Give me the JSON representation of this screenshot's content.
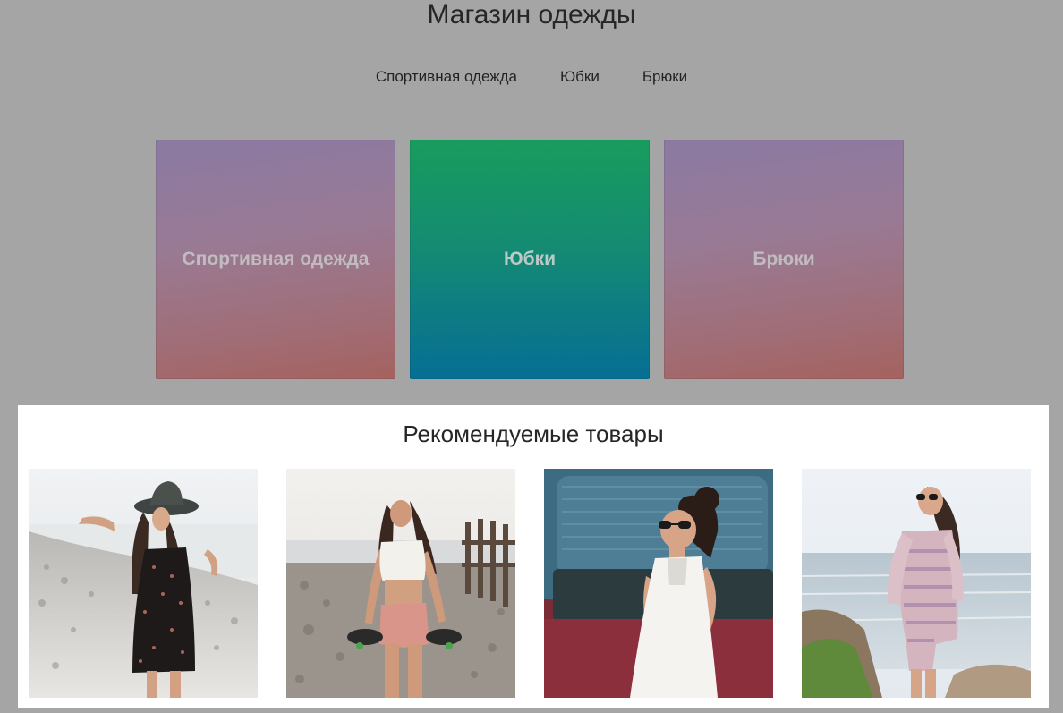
{
  "header": {
    "title": "Магазин одежды"
  },
  "nav": {
    "items": [
      {
        "label": "Спортивная одежда"
      },
      {
        "label": "Юбки"
      },
      {
        "label": "Брюки"
      }
    ]
  },
  "categories": [
    {
      "label": "Спортивная одежда",
      "color": "#9a7a96"
    },
    {
      "label": "Юбки",
      "color": "#148b72"
    },
    {
      "label": "Брюки",
      "color": "#9a7a96"
    }
  ],
  "featured": {
    "title": "Рекомендуемые товары",
    "products": [
      {
        "image": "woman-beach-hat-floral-dress"
      },
      {
        "image": "woman-beach-skateboard-white-top"
      },
      {
        "image": "woman-white-dress-sunglasses-van"
      },
      {
        "image": "woman-patterned-romper-coast"
      }
    ]
  }
}
